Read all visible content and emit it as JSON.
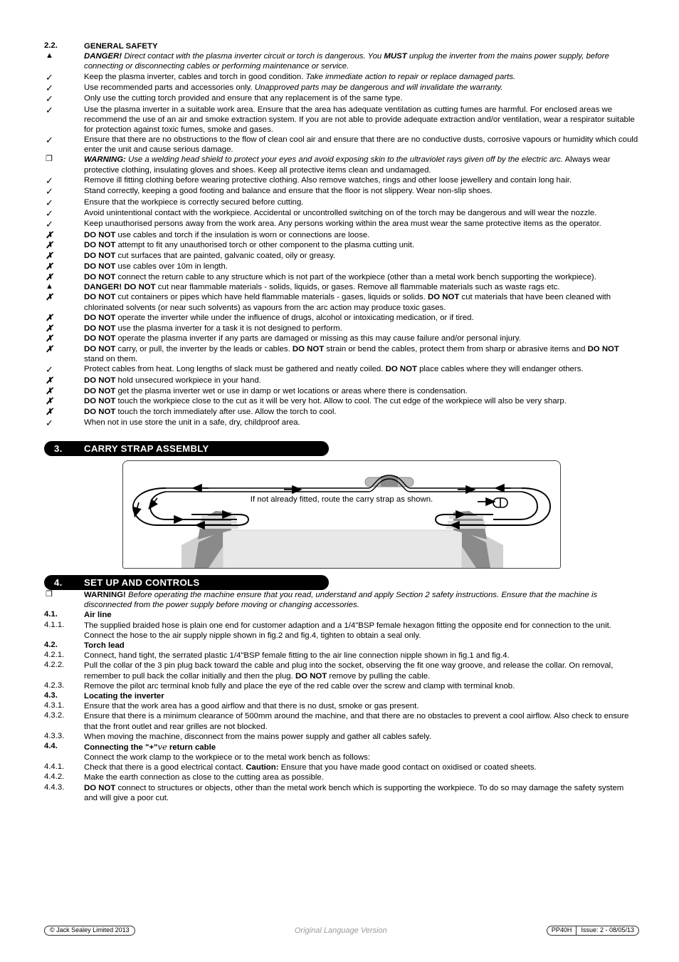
{
  "section2": {
    "number": "2.2.",
    "title": "GENERAL SAFETY",
    "items": [
      {
        "bullet": "triangle",
        "html": "<b><i>DANGER!</i></b> <i>Direct contact with the plasma inverter circuit or torch is dangerous. You <b>MUST</b> unplug the inverter from the mains power supply, before connecting or disconnecting cables or performing maintenance or service.</i>"
      },
      {
        "bullet": "check",
        "html": "Keep the plasma inverter, cables and torch in good condition. <i>Take immediate action to repair or replace damaged parts.</i>"
      },
      {
        "bullet": "check",
        "html": "Use recommended parts and accessories only. <i>Unapproved parts may be dangerous and will invalidate the warranty.</i>"
      },
      {
        "bullet": "check",
        "html": "Only use the cutting torch provided and ensure that any replacement is of the same type."
      },
      {
        "bullet": "check",
        "html": "Use the plasma inverter in a suitable work area. Ensure that the area has adequate ventilation as cutting fumes are harmful. For enclosed areas we recommend the use of an air and smoke extraction system. If you are not able to provide adequate extraction and/or ventilation, wear a respirator suitable for protection against toxic fumes, smoke and gases."
      },
      {
        "bullet": "check",
        "html": "Ensure that there are no obstructions to the flow of clean cool air and ensure that there are no conductive dusts, corrosive vapours or humidity which could enter the unit and cause serious damage."
      },
      {
        "bullet": "square",
        "html": "<b><i>WARNING:</i></b> <i>Use a welding head shield to protect your eyes and avoid exposing skin to the ultraviolet rays given off by the electric arc.</i> Always wear protective clothing, insulating gloves and shoes. Keep all protective items clean and undamaged."
      },
      {
        "bullet": "check",
        "html": "Remove ill fitting clothing before wearing protective clothing. Also remove watches, rings and other loose jewellery and contain long hair."
      },
      {
        "bullet": "check",
        "html": "Stand correctly, keeping a good footing and balance and ensure that the floor is not slippery. Wear non-slip shoes."
      },
      {
        "bullet": "check",
        "html": "Ensure that the workpiece is correctly secured before cutting."
      },
      {
        "bullet": "check",
        "html": "Avoid unintentional contact with the workpiece. Accidental or uncontrolled switching on of the torch may be dangerous and will wear the nozzle."
      },
      {
        "bullet": "check",
        "html": "Keep unauthorised persons away from the work area. Any persons working within the area must wear the same protective items as the operator."
      },
      {
        "bullet": "ex",
        "html": "<b>DO NOT</b> use cables and torch if the insulation is worn or connections are loose."
      },
      {
        "bullet": "ex",
        "html": "<b>DO NOT</b> attempt to fit any unauthorised torch or other component to the plasma cutting unit."
      },
      {
        "bullet": "ex",
        "html": "<b>DO NOT</b> cut surfaces that are painted, galvanic coated, oily or greasy."
      },
      {
        "bullet": "ex",
        "html": "<b>DO NOT</b> use cables over 10m in length."
      },
      {
        "bullet": "ex",
        "html": "<b>DO NOT</b> connect the return cable to any structure which is not part of the workpiece (other than a metal work bench supporting the workpiece)."
      },
      {
        "bullet": "triangle",
        "html": "<b>DANGER! DO NOT</b> cut near flammable materials - solids, liquids, or gases. Remove all flammable materials such as waste rags etc."
      },
      {
        "bullet": "ex",
        "html": "<b>DO NOT</b> cut containers or pipes which have held flammable materials - gases, liquids or solids. <b>DO NOT</b> cut materials that have been cleaned with chlorinated solvents (or near such solvents) as vapours from the arc action may produce toxic gases."
      },
      {
        "bullet": "ex",
        "html": "<b>DO NOT</b> operate the inverter while under the influence of drugs, alcohol or intoxicating medication, or if tired."
      },
      {
        "bullet": "ex",
        "html": "<b>DO NOT</b> use the plasma inverter for a task it is not designed to perform."
      },
      {
        "bullet": "ex",
        "html": "<b>DO NOT</b> operate the plasma inverter if any parts are damaged or missing as this may cause failure and/or personal injury."
      },
      {
        "bullet": "ex",
        "html": "<b>DO NOT</b> carry, or pull, the inverter by the leads or cables. <b>DO NOT</b> strain or bend the cables, protect them from sharp or abrasive items and <b>DO NOT</b> stand on them."
      },
      {
        "bullet": "check",
        "html": "Protect cables from heat. Long lengths of slack must be gathered and neatly coiled. <b>DO NOT</b> place cables where they will endanger others."
      },
      {
        "bullet": "ex",
        "html": "<b>DO NOT</b> hold unsecured workpiece in your hand."
      },
      {
        "bullet": "ex",
        "html": "<b>DO NOT</b> get the plasma inverter wet or use in damp or wet locations or areas where there is condensation."
      },
      {
        "bullet": "ex",
        "html": "<b>DO NOT</b> touch the workpiece close to the cut as it will be very hot. Allow to cool. The cut edge of the workpiece will also be very sharp."
      },
      {
        "bullet": "ex",
        "html": "<b>DO NOT</b> touch the torch immediately after use. Allow the torch to cool."
      },
      {
        "bullet": "check",
        "html": "When not in use store the unit in a safe, dry, childproof area."
      }
    ]
  },
  "section3": {
    "number": "3.",
    "title": "CARRY STRAP ASSEMBLY",
    "figure_caption": "If not already fitted, route the carry strap as shown."
  },
  "section4": {
    "number": "4.",
    "title": "SET UP AND CONTROLS",
    "warning": {
      "bullet": "square",
      "html": "<b>WARNING!</b> <i>Before operating the machine ensure that you read, understand and apply Section 2 safety instructions. Ensure that the machine is disconnected from the power supply before moving or changing accessories.</i>"
    },
    "blocks": [
      {
        "number": "4.1.",
        "heading": "Air line",
        "items": [
          {
            "number": "4.1.1.",
            "html": "The supplied braided hose is plain one end for customer adaption and a 1/4\"BSP female hexagon fitting the opposite end for connection to the unit. Connect the hose to the air supply nipple shown in fig.2 and fig.4, tighten to obtain a seal only."
          }
        ]
      },
      {
        "number": "4.2.",
        "heading": "Torch lead",
        "items": [
          {
            "number": "4.2.1.",
            "html": "Connect, hand tight, the serrated plastic 1/4\"BSP female fitting to the air line connection nipple shown in fig.1 and fig.4."
          },
          {
            "number": "4.2.2.",
            "html": "Pull the collar of the 3 pin plug back toward the cable and plug into the socket, observing the fit one way groove, and release the collar. On removal, remember to pull back the collar initially and then the plug. <b>DO NOT</b> remove by pulling the cable."
          },
          {
            "number": "4.2.3.",
            "html": "Remove the pilot arc terminal knob fully and place the eye of the red cable over the screw and clamp with terminal knob."
          }
        ]
      },
      {
        "number": "4.3.",
        "heading": "Locating the inverter",
        "items": [
          {
            "number": "4.3.1.",
            "html": "Ensure that the work area has a good airflow and that there is no dust, smoke or gas present."
          },
          {
            "number": "4.3.2.",
            "html": "Ensure that there is a minimum clearance of 500mm around the machine, and that there are no obstacles to prevent a cool airflow. Also check to ensure that the front outlet and rear grilles are not blocked."
          },
          {
            "number": "4.3.3.",
            "html": "When moving the machine, disconnect from the mains power supply and gather all cables safely."
          }
        ]
      },
      {
        "number": "4.4.",
        "heading": "Connecting the \"+\"<span class=\"script\">ve</span> return cable",
        "intro": "Connect the work clamp to the workpiece or to the metal work bench as follows:",
        "items": [
          {
            "number": "4.4.1.",
            "html": "Check that there is a good electrical contact. <b>Caution:</b> Ensure that you have made good contact on oxidised or coated sheets."
          },
          {
            "number": "4.4.2.",
            "html": "Make the earth connection as close to the cutting area as possible."
          },
          {
            "number": "4.4.3.",
            "html": "<b>DO NOT</b> connect to structures or objects, other than the metal work bench which is supporting the workpiece. To do so may damage the safety system and will give a poor cut."
          }
        ]
      }
    ]
  },
  "footer": {
    "copyright": "© Jack Sealey Limited 2013",
    "center": "Original Language Version",
    "model": "PP40H",
    "issue": "Issue: 2 - 08/05/13"
  },
  "glyphs": {
    "triangle": "▲",
    "check": "✓",
    "ex": "✗",
    "square": "❐"
  }
}
